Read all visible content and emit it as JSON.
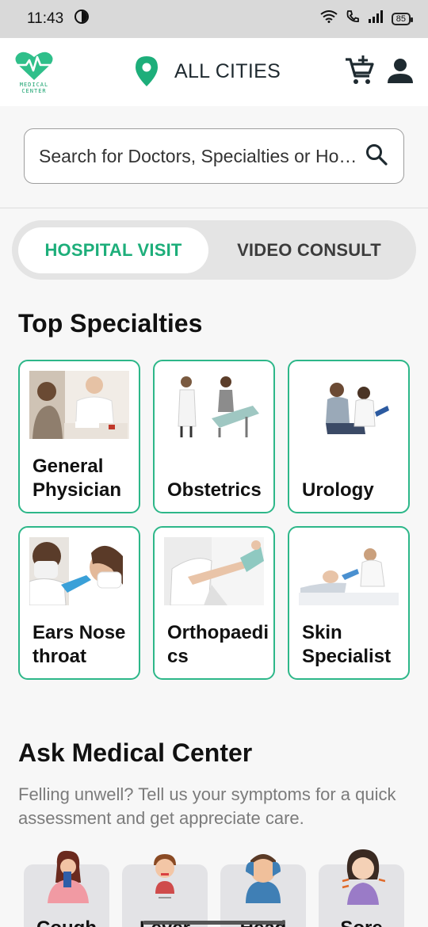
{
  "status_bar": {
    "time": "11:43",
    "battery": "85"
  },
  "header": {
    "logo_text_line1": "MEDICAL",
    "logo_text_line2": "CENTER",
    "city": "ALL CITIES",
    "icons": [
      "location-pin-icon",
      "add-to-cart-icon",
      "user-icon"
    ],
    "accent_color": "#1dae7a"
  },
  "search": {
    "placeholder": "Search for Doctors, Specialties or Hospitals"
  },
  "visit_toggle": {
    "options": [
      {
        "label": "HOSPITAL VISIT",
        "active": true
      },
      {
        "label": "VIDEO CONSULT",
        "active": false
      }
    ]
  },
  "top_specialties": {
    "title": "Top Specialties",
    "items": [
      {
        "label": "General Physician"
      },
      {
        "label": "Obstetrics"
      },
      {
        "label": "Urology"
      },
      {
        "label": "Ears Nose throat"
      },
      {
        "label": "Orthopaedics"
      },
      {
        "label": "Skin Specialist"
      }
    ]
  },
  "ask": {
    "title": "Ask Medical Center",
    "subtitle": "Felling unwell? Tell us your symptoms for a quick assessment and get appreciate care.",
    "symptoms": [
      {
        "label": "Cough"
      },
      {
        "label": "Fever"
      },
      {
        "label": "Head"
      },
      {
        "label": "Sore"
      }
    ]
  }
}
